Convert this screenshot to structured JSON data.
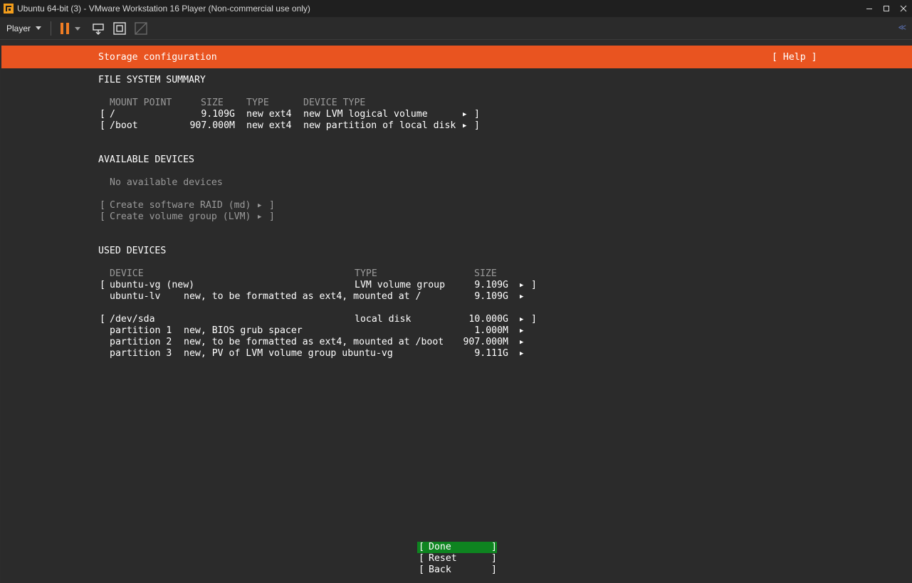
{
  "window": {
    "title": "Ubuntu 64-bit (3) - VMware Workstation 16 Player (Non-commercial use only)"
  },
  "toolbar": {
    "player_menu": "Player",
    "collapse_glyph": "≪"
  },
  "installer": {
    "header_title": "Storage configuration",
    "help_label": "[ Help ]",
    "fs_summary": {
      "heading": "FILE SYSTEM SUMMARY",
      "col_mount": "MOUNT POINT",
      "col_size": "SIZE",
      "col_type": "TYPE",
      "col_device_type": "DEVICE TYPE",
      "rows": [
        {
          "mount": "/",
          "size": "9.109G",
          "type": "new ext4",
          "device_type": "new LVM logical volume"
        },
        {
          "mount": "/boot",
          "size": "907.000M",
          "type": "new ext4",
          "device_type": "new partition of local disk"
        }
      ]
    },
    "available": {
      "heading": "AVAILABLE DEVICES",
      "empty_text": "No available devices",
      "action_raid": "Create software RAID (md)",
      "action_lvm": "Create volume group (LVM)"
    },
    "used": {
      "heading": "USED DEVICES",
      "col_device": "DEVICE",
      "col_type": "TYPE",
      "col_size": "SIZE",
      "groups": [
        {
          "device": "ubuntu-vg (new)",
          "type": "LVM volume group",
          "size": "9.109G",
          "children": [
            {
              "name": "ubuntu-lv",
              "desc": "new, to be formatted as ext4, mounted at /",
              "size": "9.109G"
            }
          ]
        },
        {
          "device": "/dev/sda",
          "type": "local disk",
          "size": "10.000G",
          "children": [
            {
              "name": "partition 1",
              "desc": "new, BIOS grub spacer",
              "size": "1.000M"
            },
            {
              "name": "partition 2",
              "desc": "new, to be formatted as ext4, mounted at /boot",
              "size": "907.000M"
            },
            {
              "name": "partition 3",
              "desc": "new, PV of LVM volume group ubuntu-vg",
              "size": "9.111G"
            }
          ]
        }
      ]
    },
    "buttons": {
      "done": "Done",
      "reset": "Reset",
      "back": "Back"
    },
    "marker_glyph": "▶",
    "open_bracket": "[",
    "close_bracket": "]"
  },
  "colors": {
    "header_orange": "#e95420",
    "done_green": "#0e8420",
    "pause_orange": "#f07d24"
  }
}
